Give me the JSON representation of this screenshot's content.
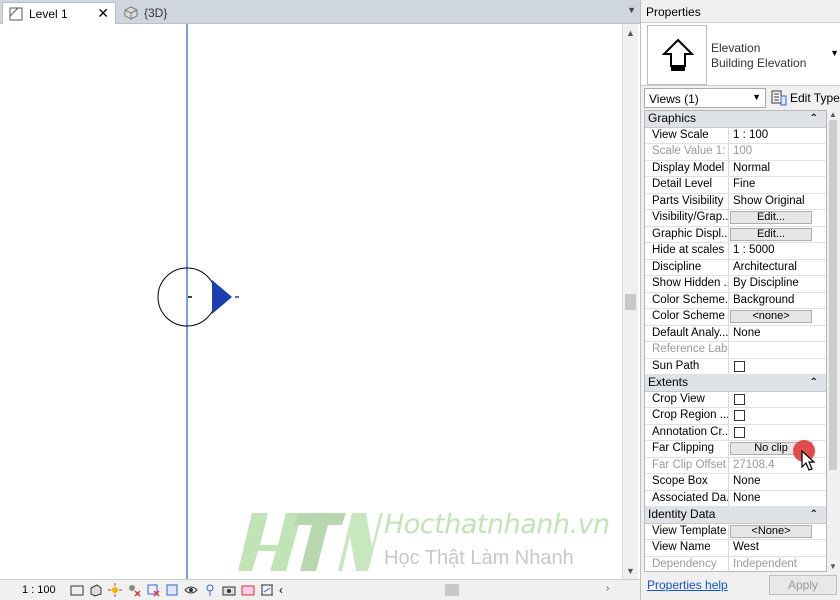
{
  "tabs": [
    {
      "label": "Level 1",
      "active": true
    },
    {
      "label": "{3D}",
      "active": false
    }
  ],
  "status": {
    "scale": "1 : 100"
  },
  "watermark": {
    "site": "Hocthatnhanh.vn",
    "slogan": "Học Thật  Làm Nhanh"
  },
  "properties": {
    "title": "Properties",
    "type_family": "Elevation",
    "type_name": "Building Elevation",
    "views_selector": "Views (1)",
    "edit_type": "Edit Type",
    "help": "Properties help",
    "apply": "Apply",
    "sections": {
      "graphics": "Graphics",
      "extents": "Extents",
      "identity": "Identity Data"
    },
    "graphics": [
      {
        "name": "View Scale",
        "value": "1 : 100"
      },
      {
        "name": "Scale Value    1:",
        "value": "100",
        "disabled": true
      },
      {
        "name": "Display Model",
        "value": "Normal"
      },
      {
        "name": "Detail Level",
        "value": "Fine"
      },
      {
        "name": "Parts Visibility",
        "value": "Show Original"
      },
      {
        "name": "Visibility/Grap...",
        "value": "Edit...",
        "button": true
      },
      {
        "name": "Graphic Displ...",
        "value": "Edit...",
        "button": true
      },
      {
        "name": "Hide at scales ...",
        "value": "1 : 5000"
      },
      {
        "name": "Discipline",
        "value": "Architectural"
      },
      {
        "name": "Show Hidden ...",
        "value": "By Discipline"
      },
      {
        "name": "Color Scheme...",
        "value": "Background"
      },
      {
        "name": "Color Scheme",
        "value": "<none>",
        "button": true
      },
      {
        "name": "Default Analy...",
        "value": "None"
      },
      {
        "name": "Reference Label",
        "value": "",
        "disabled": true
      },
      {
        "name": "Sun Path",
        "value": "",
        "checkbox": true
      }
    ],
    "extents": [
      {
        "name": "Crop View",
        "value": "",
        "checkbox": true
      },
      {
        "name": "Crop Region ...",
        "value": "",
        "checkbox": true
      },
      {
        "name": "Annotation Cr...",
        "value": "",
        "checkbox": true
      },
      {
        "name": "Far Clipping",
        "value": "No clip",
        "button": true
      },
      {
        "name": "Far Clip Offset",
        "value": "27108.4",
        "disabled": true
      },
      {
        "name": "Scope Box",
        "value": "None"
      },
      {
        "name": "Associated Da...",
        "value": "None"
      }
    ],
    "identity": [
      {
        "name": "View Template",
        "value": "<None>",
        "button": true
      },
      {
        "name": "View Name",
        "value": "West"
      },
      {
        "name": "Dependency",
        "value": "Independent",
        "disabled": true
      }
    ]
  },
  "colors": {
    "elevation_line": "#4a7fe0",
    "elevation_marker": "#1a3fb0",
    "link": "#1155cc"
  }
}
